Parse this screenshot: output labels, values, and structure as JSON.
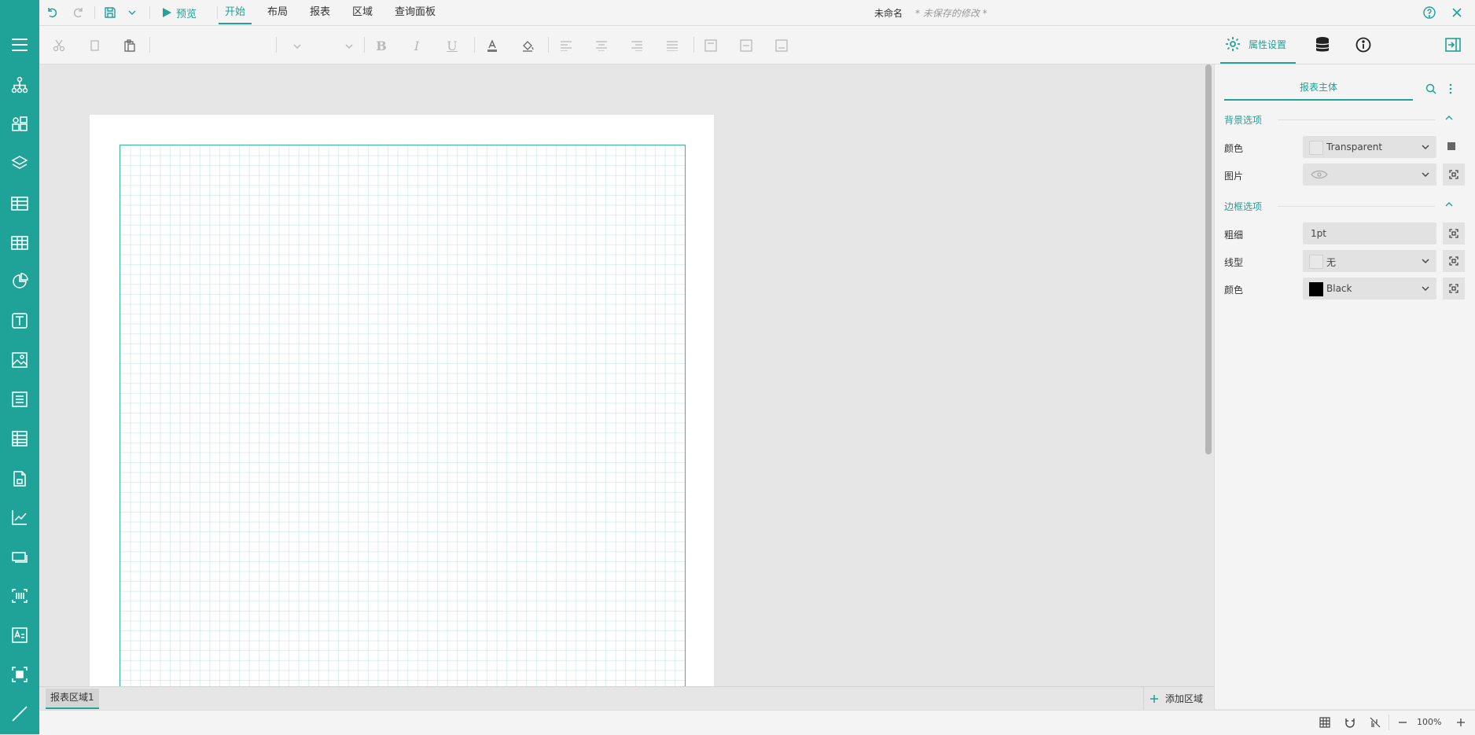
{
  "titlebar": {
    "preview_label": "预览",
    "menu_tabs": [
      "开始",
      "布局",
      "报表",
      "区域",
      "查询面板"
    ],
    "doc_name": "未命名",
    "unsaved": "* 未保存的修改 *"
  },
  "panel": {
    "tab_properties": "属性设置",
    "subtab": "报表主体",
    "bg_section": "背景选项",
    "bg_color_label": "颜色",
    "bg_color_value": "Transparent",
    "bg_image_label": "图片",
    "border_section": "边框选项",
    "border_width_label": "粗细",
    "border_width_value": "1pt",
    "border_style_label": "线型",
    "border_style_value": "无",
    "border_color_label": "颜色",
    "border_color_value": "Black"
  },
  "footer": {
    "section_tab": "报表区域1",
    "add_section": "添加区域",
    "zoom": "100%"
  },
  "colors": {
    "accent": "#1fa297",
    "border_black": "#000000"
  },
  "sidebar_icons": [
    "menu-icon",
    "tree-icon",
    "components-icon",
    "layers-icon",
    "table-icon",
    "tablix-icon",
    "chart-icon",
    "textbox-icon",
    "image-icon",
    "list-icon",
    "matrix-icon",
    "subreport-icon",
    "sparkline-icon",
    "input-icon",
    "barcode-icon",
    "richtext-icon",
    "container-icon",
    "line-icon"
  ]
}
